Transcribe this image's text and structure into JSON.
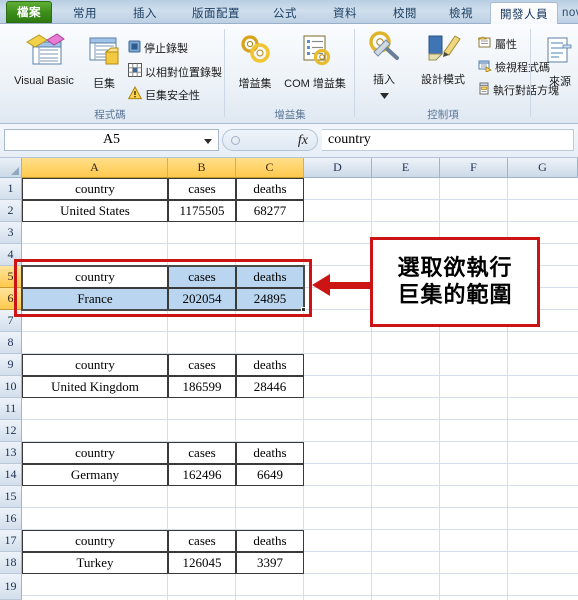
{
  "tabs": [
    {
      "label": "檔案",
      "kind": "file"
    },
    {
      "label": "常用",
      "kind": "normal"
    },
    {
      "label": "插入",
      "kind": "normal"
    },
    {
      "label": "版面配置",
      "kind": "normal"
    },
    {
      "label": "公式",
      "kind": "normal"
    },
    {
      "label": "資料",
      "kind": "normal"
    },
    {
      "label": "校閱",
      "kind": "normal"
    },
    {
      "label": "檢視",
      "kind": "normal"
    },
    {
      "label": "開發人員",
      "kind": "active"
    },
    {
      "label": "novaPDF",
      "kind": "partial"
    }
  ],
  "ribbon": {
    "groups": [
      {
        "label": "程式碼",
        "big_buttons": [
          {
            "label": "Visual Basic",
            "icon": "visual-basic-icon"
          },
          {
            "label": "巨集",
            "icon": "macro-icon"
          }
        ],
        "small_buttons": [
          {
            "label": "停止錄製",
            "icon": "stop-recording-icon"
          },
          {
            "label": "以相對位置錄製",
            "icon": "relative-reference-icon"
          },
          {
            "label": "巨集安全性",
            "icon": "macro-security-icon"
          }
        ]
      },
      {
        "label": "增益集",
        "big_buttons": [
          {
            "label": "增益集",
            "icon": "addins-icon"
          },
          {
            "label": "COM 增益集",
            "icon": "com-addins-icon"
          }
        ],
        "small_buttons": []
      },
      {
        "label": "控制項",
        "big_buttons": [
          {
            "label": "插入",
            "icon": "insert-control-icon"
          },
          {
            "label": "設計模式",
            "icon": "design-mode-icon"
          }
        ],
        "small_buttons": [
          {
            "label": "屬性",
            "icon": "properties-icon"
          },
          {
            "label": "檢視程式碼",
            "icon": "view-code-icon"
          },
          {
            "label": "執行對話方塊",
            "icon": "run-dialog-icon"
          }
        ]
      },
      {
        "label": "",
        "big_buttons": [
          {
            "label": "來源",
            "icon": "xml-source-icon"
          }
        ],
        "small_buttons": []
      }
    ]
  },
  "formula_bar": {
    "name_box": "A5",
    "fx_label": "fx",
    "content": "country"
  },
  "sheet": {
    "columns": [
      {
        "label": "A",
        "selected": true
      },
      {
        "label": "B",
        "selected": true
      },
      {
        "label": "C",
        "selected": true
      },
      {
        "label": "D",
        "selected": false
      },
      {
        "label": "E",
        "selected": false
      },
      {
        "label": "F",
        "selected": false
      },
      {
        "label": "G",
        "selected": false
      }
    ],
    "rows": [
      {
        "num": "1",
        "selected": false
      },
      {
        "num": "2",
        "selected": false
      },
      {
        "num": "3",
        "selected": false
      },
      {
        "num": "4",
        "selected": false
      },
      {
        "num": "5",
        "selected": true
      },
      {
        "num": "6",
        "selected": true
      },
      {
        "num": "7",
        "selected": false
      },
      {
        "num": "8",
        "selected": false
      },
      {
        "num": "9",
        "selected": false
      },
      {
        "num": "10",
        "selected": false
      },
      {
        "num": "11",
        "selected": false
      },
      {
        "num": "12",
        "selected": false
      },
      {
        "num": "13",
        "selected": false
      },
      {
        "num": "14",
        "selected": false
      },
      {
        "num": "15",
        "selected": false
      },
      {
        "num": "16",
        "selected": false
      },
      {
        "num": "17",
        "selected": false
      },
      {
        "num": "18",
        "selected": false
      },
      {
        "num": "19",
        "selected": false
      }
    ],
    "blocks": [
      {
        "header_row": 1,
        "headers": [
          "country",
          "cases",
          "deaths"
        ],
        "data": [
          "United States",
          "1175505",
          "68277"
        ],
        "selected": false
      },
      {
        "header_row": 5,
        "headers": [
          "country",
          "cases",
          "deaths"
        ],
        "data": [
          "France",
          "202054",
          "24895"
        ],
        "selected": true
      },
      {
        "header_row": 9,
        "headers": [
          "country",
          "cases",
          "deaths"
        ],
        "data": [
          "United Kingdom",
          "186599",
          "28446"
        ],
        "selected": false
      },
      {
        "header_row": 13,
        "headers": [
          "country",
          "cases",
          "deaths"
        ],
        "data": [
          "Germany",
          "162496",
          "6649"
        ],
        "selected": false
      },
      {
        "header_row": 17,
        "headers": [
          "country",
          "cases",
          "deaths"
        ],
        "data": [
          "Turkey",
          "126045",
          "3397"
        ],
        "selected": false
      }
    ]
  },
  "annotation": {
    "callout_line1": "選取欲執行",
    "callout_line2": "巨集的範圍",
    "accent_color": "#cc1414"
  }
}
